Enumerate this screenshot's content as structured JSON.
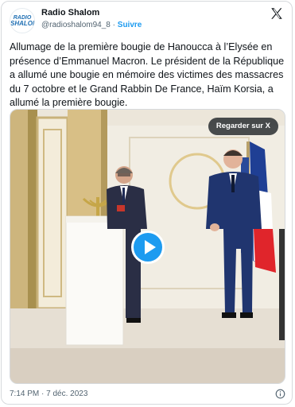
{
  "account": {
    "avatar_line1": "RADIO",
    "avatar_line2": "SHALOM",
    "display_name": "Radio Shalom",
    "handle": "@radioshalom94_8",
    "separator": "·",
    "follow_label": "Suivre"
  },
  "tweet": {
    "text": "Allumage de la première bougie de Hanoucca à l’Elysée en présence d’Emmanuel Macron. Le président de la République a allumé une bougie en mémoire des victimes des massacres du 7 octobre et le Grand Rabbin De France, Haïm Korsia, a allumé la première bougie.",
    "time": "7:14 PM",
    "date_separator": "·",
    "date": "7 déc. 2023"
  },
  "media": {
    "watch_label": "Regarder sur X"
  },
  "icons": {
    "logo": "x-logo-icon",
    "play": "play-icon",
    "info": "info-icon"
  },
  "colors": {
    "accent": "#1d9bf0",
    "text": "#0f1419",
    "muted": "#536471"
  }
}
